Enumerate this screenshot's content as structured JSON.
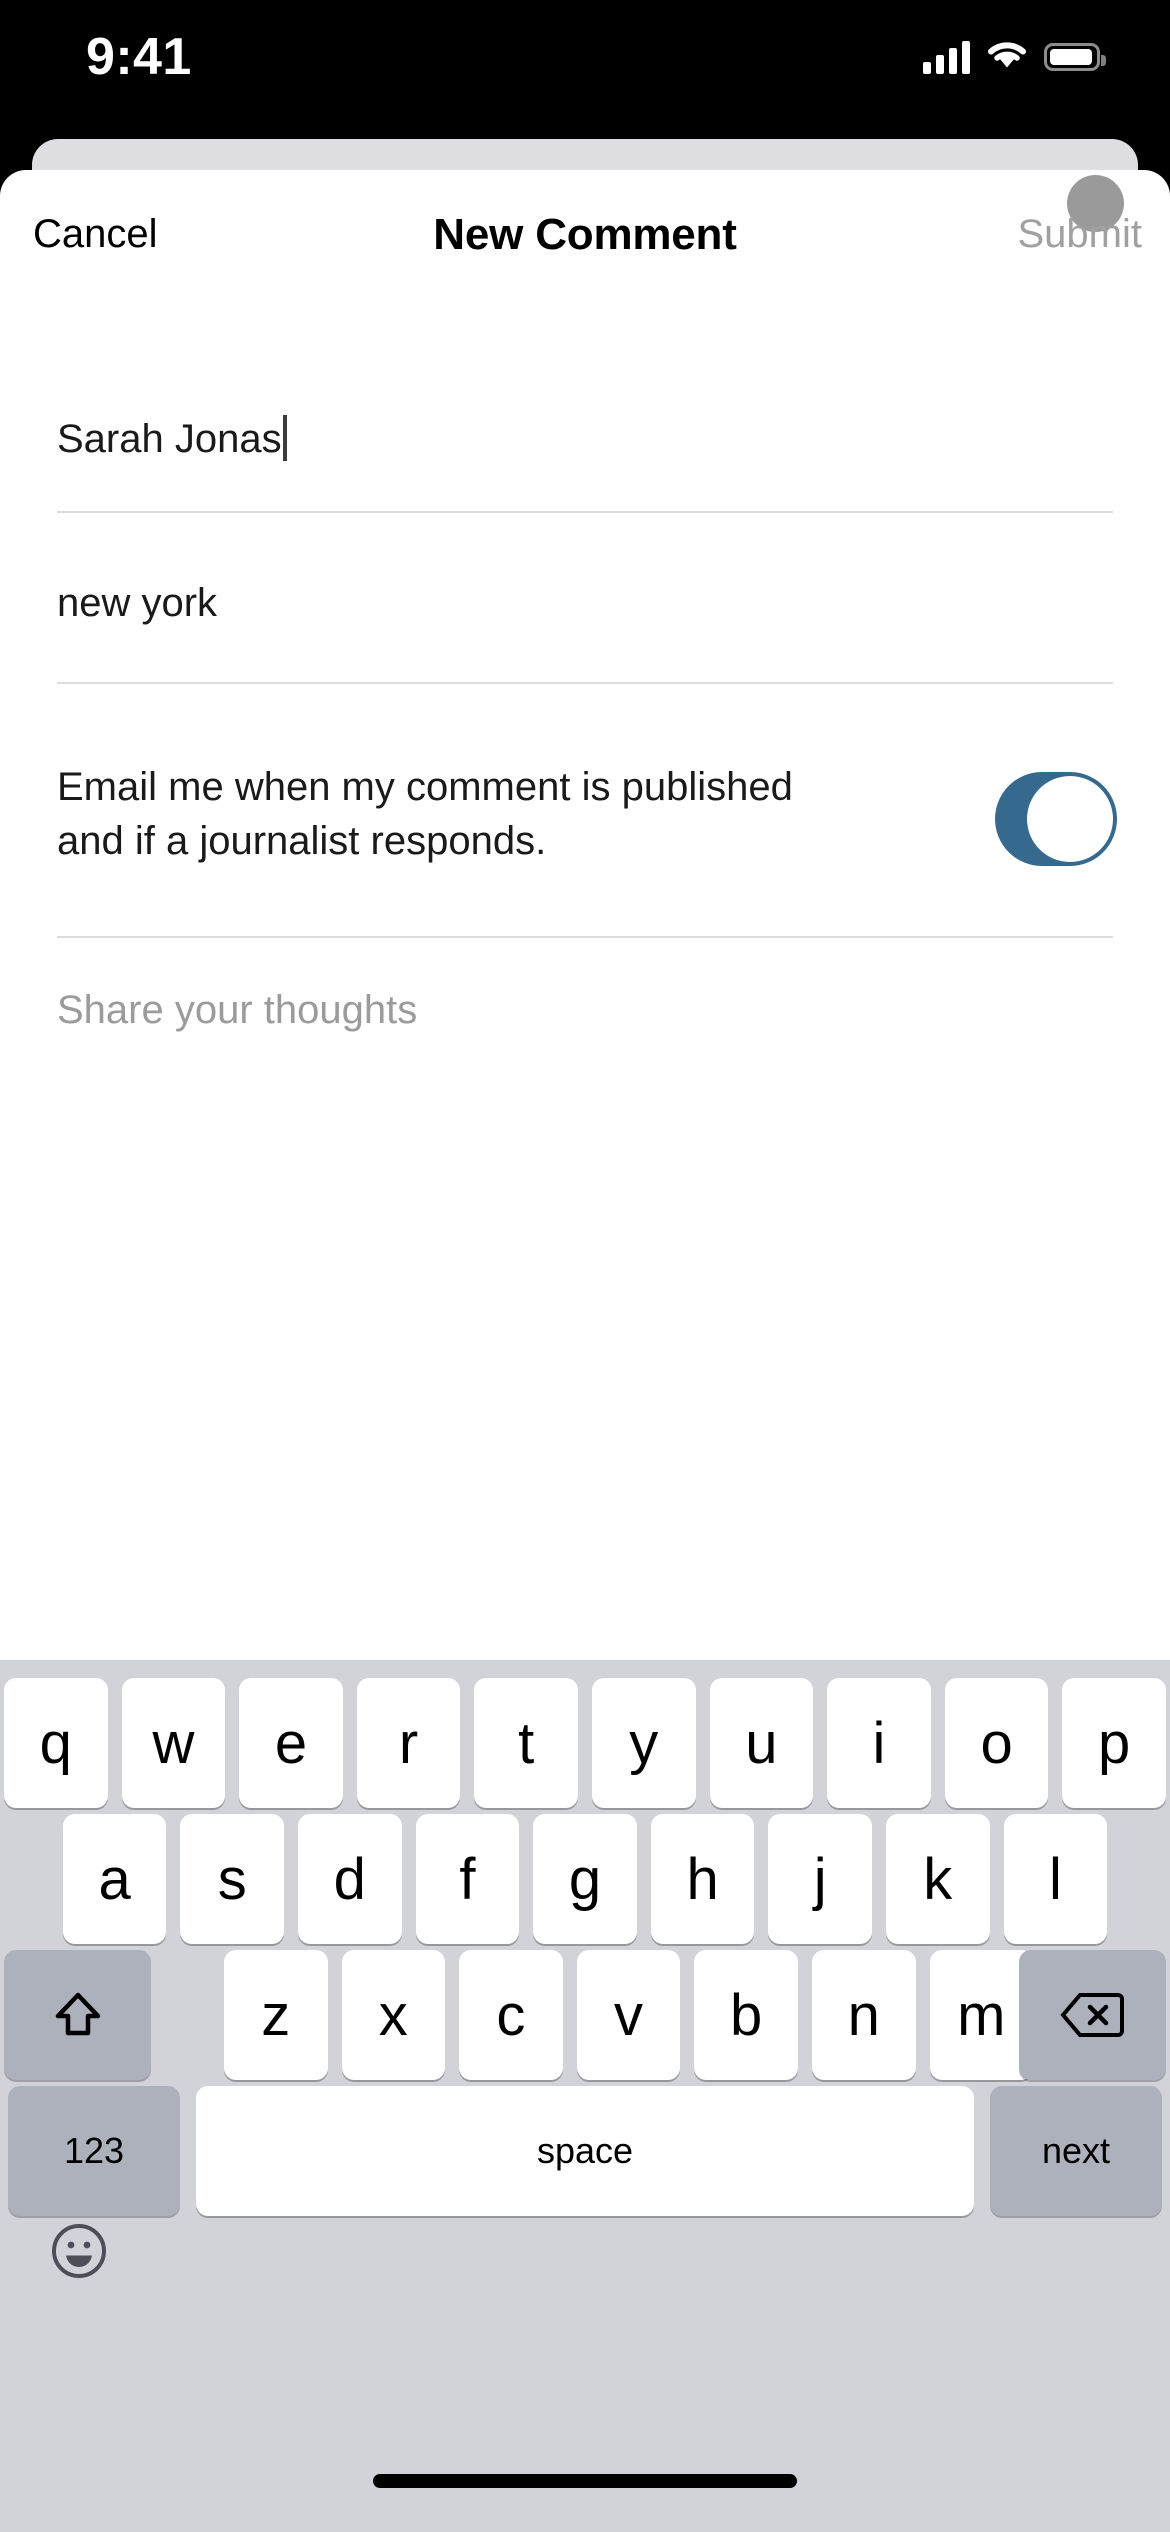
{
  "status_bar": {
    "time": "9:41",
    "signal_icon": "cellular-bars-icon",
    "wifi_icon": "wifi-icon",
    "battery_icon": "battery-icon"
  },
  "sheet": {
    "nav": {
      "cancel_label": "Cancel",
      "title": "New Comment",
      "submit_label": "Submit",
      "submit_disabled": true,
      "avatar_icon": "avatar-placeholder"
    },
    "form": {
      "name_value": "Sarah Jonas",
      "location_value": "new york",
      "notify_label": "Email me when my comment is published and if a journalist responds.",
      "notify_enabled": true,
      "comment_placeholder": "Share your thoughts"
    }
  },
  "keyboard": {
    "row1": [
      "q",
      "w",
      "e",
      "r",
      "t",
      "y",
      "u",
      "i",
      "o",
      "p"
    ],
    "row2": [
      "a",
      "s",
      "d",
      "f",
      "g",
      "h",
      "j",
      "k",
      "l"
    ],
    "row3": [
      "z",
      "x",
      "c",
      "v",
      "b",
      "n",
      "m"
    ],
    "shift_icon": "shift-arrow-icon",
    "backspace_icon": "backspace-delete-icon",
    "numbers_label": "123",
    "space_label": "space",
    "return_label": "next",
    "emoji_icon": "emoji-smiley-icon"
  },
  "colors": {
    "toggle_on": "#36698E",
    "keyboard_bg": "#D1D3D9",
    "key_white": "#FFFFFF",
    "key_gray": "#ADB1BB",
    "submit_disabled": "#A0A0A0",
    "placeholder": "#9B9B9B",
    "divider": "#DCDCDC",
    "avatar": "#9A9A9A"
  },
  "home_indicator": "home-indicator-bar"
}
